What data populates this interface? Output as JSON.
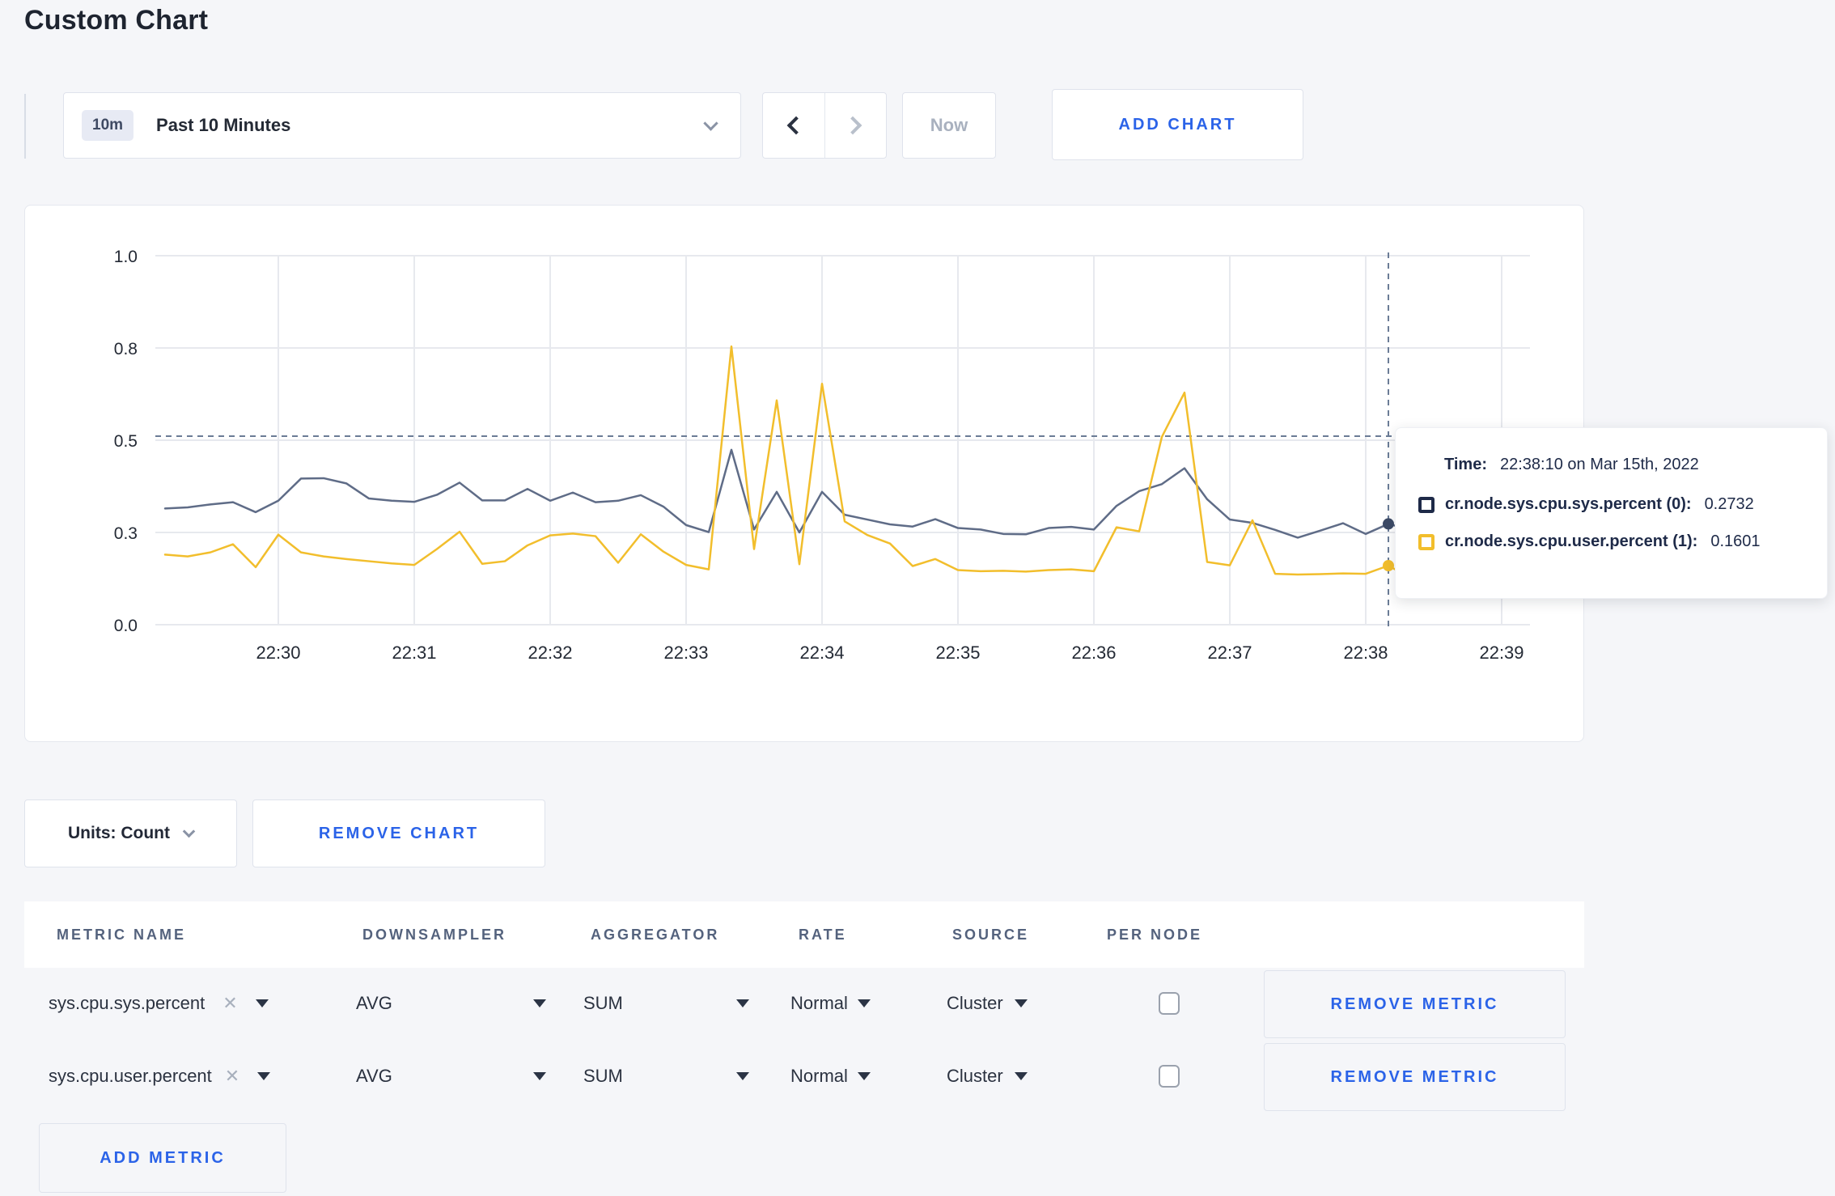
{
  "page": {
    "title": "Custom Chart",
    "background": "#f5f6f9"
  },
  "colors": {
    "accent_blue": "#2b63e8",
    "series_sys": "#5F6C87",
    "series_user": "#F2BE2C",
    "grid": "#e7e9ee",
    "crosshair": "#6b7c96",
    "dark_text": "#242a35",
    "header_text": "#54627d",
    "disabled_text": "#a9b1bf"
  },
  "toolbar": {
    "time_range_badge": "10m",
    "time_range_label": "Past 10 Minutes",
    "now_label": "Now",
    "add_chart_label": "ADD CHART"
  },
  "chart_data": {
    "type": "line",
    "title": "",
    "xlabel": "",
    "ylabel": "",
    "ylim": [
      0,
      1
    ],
    "grid": true,
    "legend_position": "none",
    "x_start": "22:29:10",
    "x_interval_seconds": 10,
    "x_ticks": [
      {
        "label": "22:30",
        "index": 5
      },
      {
        "label": "22:31",
        "index": 11
      },
      {
        "label": "22:32",
        "index": 17
      },
      {
        "label": "22:33",
        "index": 23
      },
      {
        "label": "22:34",
        "index": 29
      },
      {
        "label": "22:35",
        "index": 35
      },
      {
        "label": "22:36",
        "index": 41
      },
      {
        "label": "22:37",
        "index": 47
      },
      {
        "label": "22:38",
        "index": 53
      },
      {
        "label": "22:39",
        "index": 59
      }
    ],
    "y_ticks": [
      {
        "label": "1.0",
        "value": 1.0
      },
      {
        "label": "0.8",
        "value": 0.75
      },
      {
        "label": "0.5",
        "value": 0.5
      },
      {
        "label": "0.3",
        "value": 0.25
      },
      {
        "label": "0.0",
        "value": 0.0
      }
    ],
    "series": [
      {
        "name": "cr.node.sys.cpu.sys.percent",
        "color": "#5F6C87",
        "values": [
          0.315,
          0.318,
          0.326,
          0.332,
          0.305,
          0.336,
          0.396,
          0.397,
          0.383,
          0.342,
          0.336,
          0.333,
          0.352,
          0.385,
          0.337,
          0.337,
          0.368,
          0.336,
          0.358,
          0.332,
          0.336,
          0.351,
          0.32,
          0.27,
          0.251,
          0.474,
          0.258,
          0.36,
          0.25,
          0.36,
          0.298,
          0.285,
          0.272,
          0.266,
          0.286,
          0.262,
          0.258,
          0.246,
          0.245,
          0.262,
          0.265,
          0.258,
          0.322,
          0.362,
          0.381,
          0.424,
          0.34,
          0.285,
          0.276,
          0.257,
          0.236,
          0.255,
          0.275,
          0.246,
          0.2732,
          0.257,
          0.281,
          0.254,
          0.275,
          0.264,
          0.268
        ]
      },
      {
        "name": "cr.node.sys.cpu.user.percent",
        "color": "#F2BE2C",
        "values": [
          0.19,
          0.185,
          0.196,
          0.218,
          0.156,
          0.244,
          0.196,
          0.185,
          0.178,
          0.172,
          0.166,
          0.162,
          0.205,
          0.252,
          0.165,
          0.172,
          0.215,
          0.242,
          0.247,
          0.24,
          0.168,
          0.245,
          0.198,
          0.162,
          0.15,
          0.754,
          0.205,
          0.608,
          0.164,
          0.653,
          0.28,
          0.243,
          0.22,
          0.159,
          0.178,
          0.148,
          0.145,
          0.146,
          0.144,
          0.148,
          0.15,
          0.145,
          0.264,
          0.253,
          0.509,
          0.629,
          0.17,
          0.161,
          0.283,
          0.138,
          0.136,
          0.137,
          0.139,
          0.138,
          0.1601,
          0.126,
          0.123,
          0.132,
          0.205,
          0.206,
          0.168
        ]
      }
    ],
    "crosshair": {
      "time": "22:38:10",
      "x_index": 54,
      "hline_value": 0.511,
      "sys_value": 0.2732,
      "user_value": 0.1601
    }
  },
  "tooltip": {
    "time_label": "Time:",
    "time_value": "22:38:10 on Mar 15th, 2022",
    "rows": [
      {
        "label": "cr.node.sys.cpu.sys.percent (0):",
        "value": "0.2732",
        "color": "#1e2a48"
      },
      {
        "label": "cr.node.sys.cpu.user.percent (1):",
        "value": "0.1601",
        "color": "#F2BE2C"
      }
    ]
  },
  "chart_footer": {
    "units_label": "Units: Count",
    "remove_chart_label": "REMOVE CHART"
  },
  "metrics_table": {
    "headers": [
      "METRIC NAME",
      "DOWNSAMPLER",
      "AGGREGATOR",
      "RATE",
      "SOURCE",
      "PER NODE"
    ],
    "rows": [
      {
        "name": "sys.cpu.sys.percent",
        "downsampler": "AVG",
        "aggregator": "SUM",
        "rate": "Normal",
        "source": "Cluster",
        "per_node_checked": false,
        "remove_label": "REMOVE METRIC"
      },
      {
        "name": "sys.cpu.user.percent",
        "downsampler": "AVG",
        "aggregator": "SUM",
        "rate": "Normal",
        "source": "Cluster",
        "per_node_checked": false,
        "remove_label": "REMOVE METRIC"
      }
    ],
    "add_metric_label": "ADD METRIC"
  }
}
